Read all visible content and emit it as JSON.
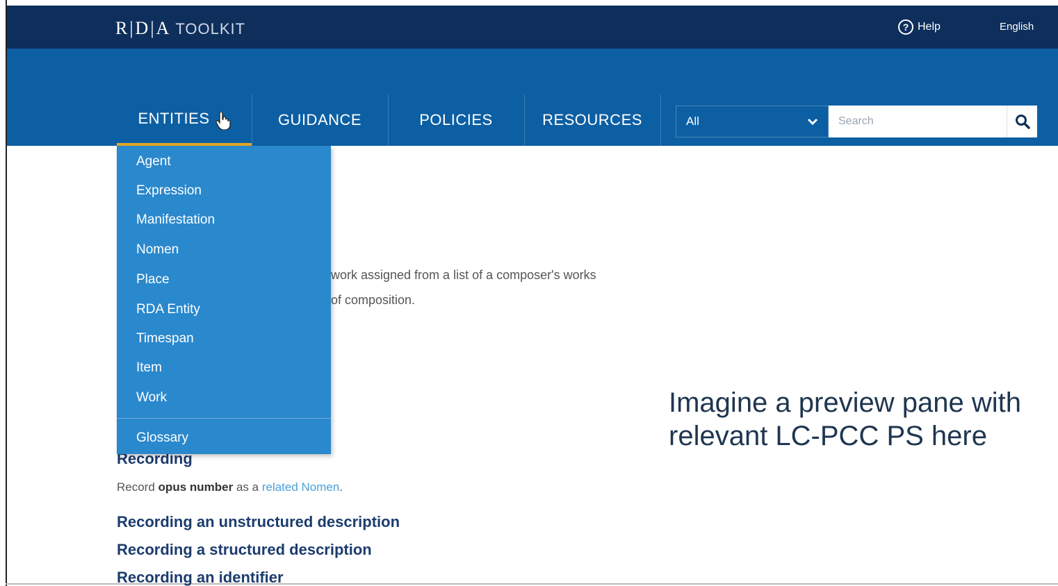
{
  "header": {
    "logo_main": "R|D|A",
    "logo_sub": "TOOLKIT",
    "help_label": "Help",
    "language_label": "English"
  },
  "nav": {
    "items": [
      {
        "label": "ENTITIES"
      },
      {
        "label": "GUIDANCE"
      },
      {
        "label": "POLICIES"
      },
      {
        "label": "RESOURCES"
      }
    ],
    "active_index": 0
  },
  "search": {
    "scope_value": "All",
    "placeholder": "Search"
  },
  "entities_menu": {
    "items": [
      "Agent",
      "Expression",
      "Manifestation",
      "Nomen",
      "Place",
      "RDA Entity",
      "Timespan",
      "Item",
      "Work"
    ],
    "glossary_label": "Glossary"
  },
  "content": {
    "partial_line_1": "work assigned from a list of a composer's works",
    "partial_line_2": "of composition.",
    "recording_heading": "Recording",
    "note_prefix": "Record",
    "note_bold": "opus number",
    "note_mid": "as a",
    "note_link": "related Nomen",
    "note_end": ".",
    "links": [
      "Recording an unstructured description",
      "Recording a structured description",
      "Recording an identifier"
    ]
  },
  "overlay_text": "Imagine a preview pane with relevant LC-PCC PS here",
  "colors": {
    "topbar": "#0e2f5c",
    "navbar": "#0d5fa3",
    "dropdown": "#2a88cd",
    "active_underline": "#e5a823",
    "heading": "#1c3c6e",
    "link": "#4aa0d8"
  }
}
